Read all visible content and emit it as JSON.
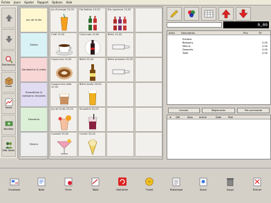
{
  "menu": [
    "Fichier",
    "Jours",
    "Ajuster",
    "Rapport",
    "Options",
    "Aide"
  ],
  "left_toolbar": [
    {
      "label": "",
      "icon": "arrow-up-icon"
    },
    {
      "label": "",
      "icon": "arrow-down-icon"
    },
    {
      "label": "Recherche",
      "icon": "magnifier-icon"
    },
    {
      "label": "Tasse",
      "icon": "box-icon"
    },
    {
      "label": "Vente",
      "icon": "chart-icon"
    },
    {
      "label": "Numéro",
      "icon": "cash-icon"
    },
    {
      "label": "Etat Stock",
      "icon": "people-icon"
    }
  ],
  "categories": [
    {
      "label": "Jus de fruits",
      "color": "#fff7d0"
    },
    {
      "label": "Sodas",
      "color": "#d9f2f5"
    },
    {
      "label": "Sandwichs & mets",
      "color": "#f8d6d6"
    },
    {
      "label": "Smoothies & boissons chaudes",
      "color": "#e1dcf2"
    },
    {
      "label": "Desserts",
      "color": "#dcf0d8"
    },
    {
      "label": "Divers",
      "color": "#eeeeee"
    }
  ],
  "products": [
    {
      "label": "Jus d'orange 15,00",
      "icon": "orange-juice-icon"
    },
    {
      "label": "Fat Bottles 10,00",
      "icon": "bottles-icon"
    },
    {
      "label": "Eau gazeuse 10,00",
      "icon": "bottles-icon"
    },
    {
      "label": "",
      "icon": ""
    },
    {
      "label": "Café 15,00",
      "icon": "coffee-cup-icon"
    },
    {
      "label": "Coca-cola 10,00",
      "icon": "coke-bottle-icon"
    },
    {
      "label": "Bière 10,00",
      "icon": "lying-bottle-icon"
    },
    {
      "label": "",
      "icon": ""
    },
    {
      "label": "Capuccino 15,00",
      "icon": "cappuccino-icon"
    },
    {
      "label": "Bière 25,00",
      "icon": "beer-bottle-icon"
    },
    {
      "label": "Bière pression 20,00",
      "icon": "lying-bottle-icon"
    },
    {
      "label": "",
      "icon": ""
    },
    {
      "label": "Cappuccino latte 20,00",
      "icon": "latte-icon"
    },
    {
      "label": "Bière locale 20,00",
      "icon": "beer-glass-icon"
    },
    {
      "label": "",
      "icon": ""
    },
    {
      "label": "",
      "icon": ""
    },
    {
      "label": "Jus de fruits 25,00",
      "icon": "fruit-drink-icon"
    },
    {
      "label": "Smoothie 20,00",
      "icon": "smoothie-icon"
    },
    {
      "label": "",
      "icon": ""
    },
    {
      "label": "",
      "icon": ""
    },
    {
      "label": "Cocktail 30,00",
      "icon": "cocktail-icon"
    },
    {
      "label": "Cornet 20,00",
      "icon": "ice-cream-icon"
    },
    {
      "label": "",
      "icon": ""
    },
    {
      "label": "",
      "icon": ""
    }
  ],
  "right_toolbar": [
    {
      "icon": "pencil-icon"
    },
    {
      "icon": "color-icon"
    },
    {
      "icon": "table-icon"
    },
    {
      "icon": "up-arrow-red-icon"
    },
    {
      "icon": "down-arrow-red-icon"
    }
  ],
  "total_display": "0,00",
  "order_head": {
    "col1": "Articl",
    "col2": "Description",
    "col3": "Prix",
    "col4": "Ttl"
  },
  "order_lines": [
    {
      "name": "Entrées",
      "val": ""
    },
    {
      "name": "Boissons",
      "val": "0,00"
    },
    {
      "name": "Menus",
      "val": "0,00"
    },
    {
      "name": "Desserts",
      "val": "0,00"
    },
    {
      "name": "Total",
      "val": "0,00"
    }
  ],
  "tabs": [
    "Annuler",
    "Réglements",
    "Pré-commande"
  ],
  "bottom_head": [
    "#",
    "Qté",
    "Nom",
    "Article",
    "Date",
    "Etat"
  ],
  "bottom_buttons": [
    {
      "label": "Encaisser",
      "icon": "pay-icon"
    },
    {
      "label": "Note",
      "icon": "note-icon"
    },
    {
      "label": "Fiche",
      "icon": "card-icon"
    },
    {
      "label": "Table",
      "icon": "table-icon"
    },
    {
      "label": "Rafraîchir",
      "icon": "refresh-icon"
    },
    {
      "label": "Ticket",
      "icon": "ticket-icon"
    },
    {
      "label": "Historique",
      "icon": "history-icon"
    },
    {
      "label": "Stock",
      "icon": "stock-icon"
    },
    {
      "label": "Suppr",
      "icon": "trash-icon"
    },
    {
      "label": "Fermer",
      "icon": "close-icon"
    }
  ]
}
